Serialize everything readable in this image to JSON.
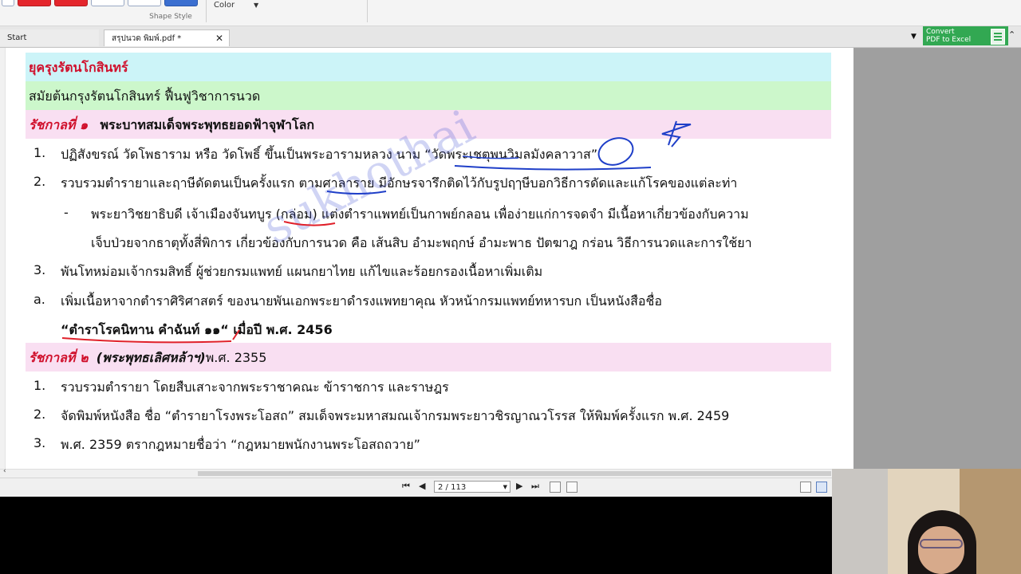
{
  "ribbon": {
    "group_label": "Shape Style",
    "color_label": "Color"
  },
  "tabs": [
    {
      "label": "Start"
    },
    {
      "label": "สรุปนวด พิมพ์.pdf *"
    }
  ],
  "convert_button": {
    "line1": "Convert",
    "line2": "PDF to Excel"
  },
  "document": {
    "header_era": "ยุครุงรัตนโกสินทร์",
    "header_sub": "สมัยต้นกรุงรัตนโกสินทร์ ฟื้นฟูวิชาการนวด",
    "reign1": {
      "label": "รัชกาลที่ ๑",
      "title": "พระบาทสมเด็จพระพุทธยอดฟ้าจุฬาโลก"
    },
    "items1": [
      {
        "num": "1.",
        "text": "ปฏิสังขรณ์ วัดโพธาราม  หรือ วัดโพธิ์ ขึ้นเป็นพระอารามหลวง  นาม “วัดพระเชตุพนวิมลมังคลาวาส”"
      },
      {
        "num": "2.",
        "text": "รวบรวมตำรายาและฤาษีดัดตนเป็นครั้งแรก ตามศาลาราย มีอักษรจารึกติดไว้กับรูปฤๅษีบอกวิธีการดัดและแก้โรคของแต่ละท่า"
      },
      {
        "num": "-",
        "text": "พระยาวิชยาธิบดี เจ้าเมืองจันทบูร (กล่อม) แต่งตำราแพทย์เป็นกาพย์กลอน เพื่อง่ายแก่การจดจำ มีเนื้อหาเกี่ยวข้องกับความ"
      },
      {
        "num": "",
        "text": "เจ็บป่วยจากธาตุทั้งสี่พิการ เกี่ยวข้องกับการนวด คือ เส้นสิบ อำมะพฤกษ์ อำมะพาธ ปัตฆาฎ  กร่อน วิธีการนวดและการใช้ยา"
      },
      {
        "num": "3.",
        "text": "พันโทหม่อมเจ้ากรมสิทธิ์ ผู้ช่วยกรมแพทย์ แผนกยาไทย แก้ไขและร้อยกรองเนื้อหาเพิ่มเติม"
      },
      {
        "num": "a.",
        "text": "เพิ่มเนื้อหาจากตำราศิริศาสตร์ ของนายพันเอกพระยาดำรงแพทยาคุณ หัวหน้ากรมแพทย์ทหารบก  เป็นหนังสือชื่อ"
      }
    ],
    "book_title": "“ตำราโรคนิทาน คำฉันท์ ๑๑“",
    "book_year": " เมื่อปี พ.ศ. 2456",
    "reign2": {
      "label": "รัชกาลที่ ๒",
      "title": "(พระพุทธเลิศหล้าฯ)",
      "year": "พ.ศ. 2355"
    },
    "items2": [
      {
        "num": "1.",
        "text": "รวบรวมตำรายา โดยสืบเสาะจากพระราชาคณะ ข้าราชการ และราษฎร"
      },
      {
        "num": "2.",
        "text": "จัดพิมพ์หนังสือ ชื่อ “ตำรายาโรงพระโอสถ”  สมเด็จพระมหาสมณเจ้ากรมพระยาวชิรญาณวโรรส ให้พิมพ์ครั้งแรก พ.ศ. 2459"
      },
      {
        "num": "3.",
        "text": "พ.ศ. 2359 ตรากฎหมายชื่อว่า  “กฎหมายพนักงานพระโอสถถวาย”"
      }
    ]
  },
  "watermark": "sukhothai",
  "status_bar": {
    "page_indicator": "2 / 113"
  }
}
